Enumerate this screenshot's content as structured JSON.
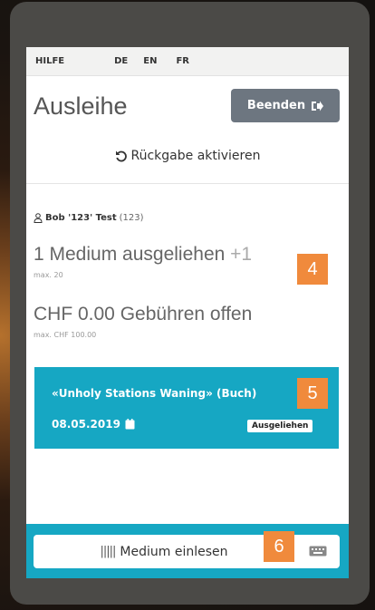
{
  "topbar": {
    "help": "HILFE",
    "languages": [
      "DE",
      "EN",
      "FR"
    ]
  },
  "header": {
    "title": "Ausleihe",
    "end_button": "Beenden"
  },
  "return_action": "Rückgabe aktivieren",
  "user": {
    "name": "Bob '123' Test",
    "id": "(123)"
  },
  "loans": {
    "summary": "1 Medium ausgeliehen",
    "extra": "+1",
    "max": "max. 20"
  },
  "fees": {
    "summary": "CHF 0.00 Gebühren offen",
    "max": "max. CHF 100.00"
  },
  "loan_card": {
    "title": "«Unholy Stations Waning» (Buch)",
    "due_date": "08.05.2019",
    "status": "Ausgeliehen"
  },
  "scan": {
    "label": "Medium einlesen",
    "barcode_glyph": "|||||"
  },
  "annotations": {
    "n4": "4",
    "n5": "5",
    "n6": "6"
  },
  "colors": {
    "accent": "#16a7c3",
    "badge": "#f08a3c",
    "button": "#6d7680"
  }
}
